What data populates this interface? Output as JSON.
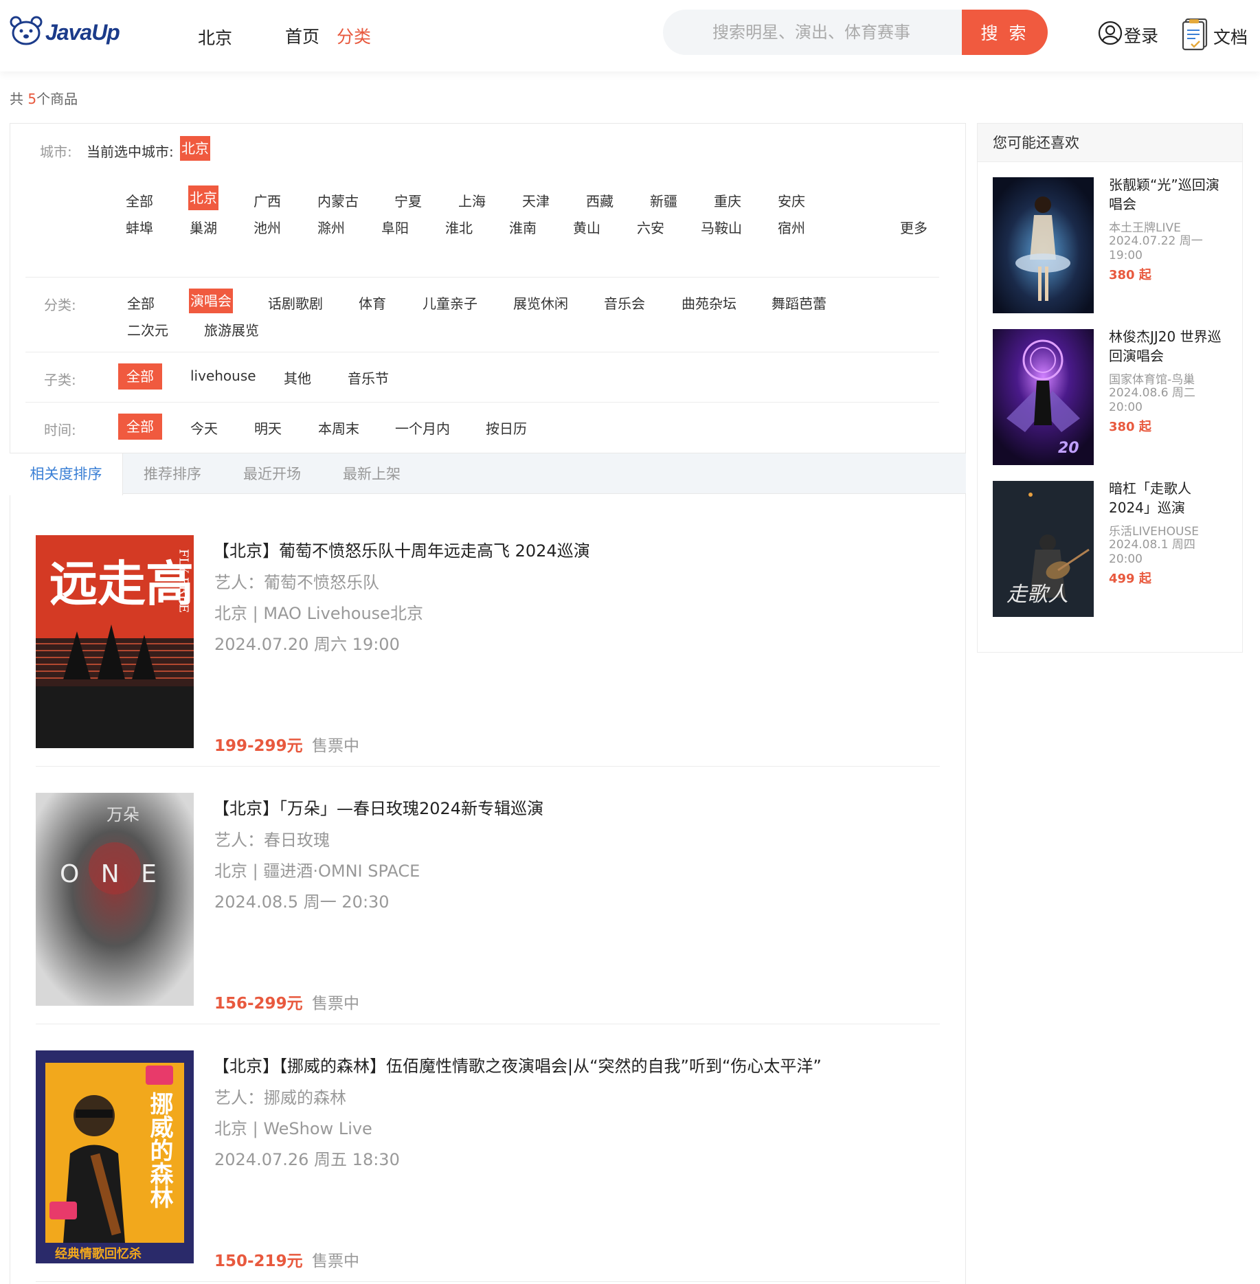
{
  "header": {
    "logo_text": "JavaUp",
    "city": "北京",
    "nav_home": "首页",
    "nav_category": "分类",
    "search_placeholder": "搜索明星、演出、体育赛事",
    "search_button": "搜 索",
    "login": "登录",
    "docs": "文档"
  },
  "summary": {
    "prefix": "共 ",
    "count": "5",
    "suffix": "个商品"
  },
  "filters": {
    "city_label": "城市:",
    "current_city_prefix": "当前选中城市:",
    "current_city": "北京",
    "cities_row1": [
      "全部",
      "北京",
      "广西",
      "内蒙古",
      "宁夏",
      "上海",
      "天津",
      "西藏",
      "新疆",
      "重庆",
      "安庆"
    ],
    "cities_row2": [
      "蚌埠",
      "巢湖",
      "池州",
      "滁州",
      "阜阳",
      "淮北",
      "淮南",
      "黄山",
      "六安",
      "马鞍山",
      "宿州"
    ],
    "more": "更多",
    "category_label": "分类:",
    "categories": [
      "全部",
      "演唱会",
      "话剧歌剧",
      "体育",
      "儿童亲子",
      "展览休闲",
      "音乐会",
      "曲苑杂坛",
      "舞蹈芭蕾",
      "二次元",
      "旅游展览"
    ],
    "subcategory_label": "子类:",
    "subcategories": [
      "全部",
      "livehouse",
      "其他",
      "音乐节"
    ],
    "time_label": "时间:",
    "times": [
      "全部",
      "今天",
      "明天",
      "本周末",
      "一个月内",
      "按日历"
    ]
  },
  "sort_tabs": [
    "相关度排序",
    "推荐排序",
    "最近开场",
    "最新上架"
  ],
  "items": [
    {
      "title": "【北京】葡萄不愤怒乐队十周年远走高飞 2024巡演",
      "artist": "艺人：葡萄不愤怒乐队",
      "venue": "北京 | MAO Livehouse北京",
      "date": "2024.07.20 周六 19:00",
      "price": "199-299元",
      "status": "售票中",
      "poster_text": "远走高飞",
      "poster_side": "FLY FREE"
    },
    {
      "title": "【北京】「万朵」—春日玫瑰2024新专辑巡演",
      "artist": "艺人：春日玫瑰",
      "venue": "北京 | 疆进酒·OMNI SPACE",
      "date": "2024.08.5 周一 20:30",
      "price": "156-299元",
      "status": "售票中",
      "poster_text": "O N E",
      "poster_side": "万朵"
    },
    {
      "title": "【北京】【挪威的森林】伍佰魔性情歌之夜演唱会|从“突然的自我”听到“伤心太平洋”",
      "artist": "艺人：挪威的森林",
      "venue": "北京 | WeShow Live",
      "date": "2024.07.26 周五 18:30",
      "price": "150-219元",
      "status": "售票中",
      "poster_text": "挪威的森林",
      "poster_side": "经典情歌回忆杀"
    }
  ],
  "sidebar": {
    "title": "您可能还喜欢",
    "recs": [
      {
        "title": "张靓颖“光”巡回演唱会",
        "venue": "本土王牌LIVE",
        "date": "2024.07.22 周一 19:00",
        "price": "380 起"
      },
      {
        "title": "林俊杰JJ20 世界巡回演唱会",
        "venue": "国家体育馆-鸟巢",
        "date": "2024.08.6 周二 20:00",
        "price": "380 起"
      },
      {
        "title": "暗杠「走歌人 2024」巡演",
        "venue": "乐活LIVEHOUSE",
        "date": "2024.08.1 周四 20:00",
        "price": "499 起"
      }
    ]
  },
  "colors": {
    "accent": "#f05a3f",
    "tab_active": "#3a7fd5",
    "brand": "#1b3b8a"
  },
  "icons": [
    "bear-logo-icon",
    "user-icon",
    "document-icon"
  ]
}
